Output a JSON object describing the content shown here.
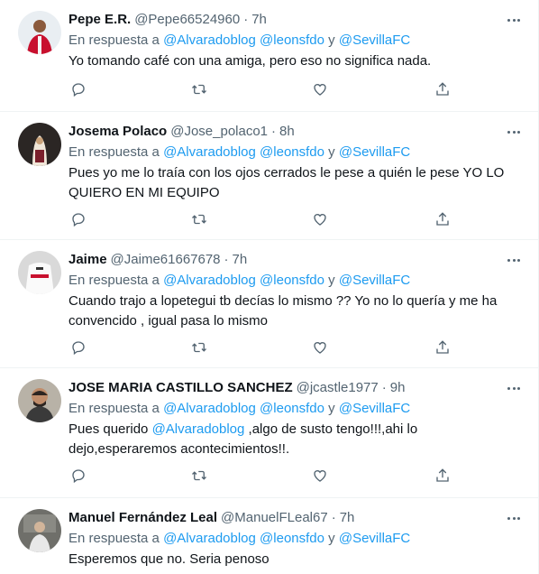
{
  "reply_prefix": "En respuesta a",
  "reply_joiner": "y",
  "separator": "·",
  "tweets": [
    {
      "name": "Pepe E.R.",
      "handle": "@Pepe66524960",
      "time": "7h",
      "mentions": [
        "@Alvaradoblog",
        "@leonsfdo",
        "@SevillaFC"
      ],
      "text": "Yo tomando café con una amiga,  pero eso no significa nada."
    },
    {
      "name": "Josema Polaco",
      "handle": "@Jose_polaco1",
      "time": "8h",
      "mentions": [
        "@Alvaradoblog",
        "@leonsfdo",
        "@SevillaFC"
      ],
      "text_line1": "Pues yo me lo traía con los ojos cerrados le pese a quién le pese YO LO",
      "text_line2": "QUIERO EN MI EQUIPO"
    },
    {
      "name": "Jaime",
      "handle": "@Jaime61667678",
      "time": "7h",
      "mentions": [
        "@Alvaradoblog",
        "@leonsfdo",
        "@SevillaFC"
      ],
      "text_line1": "Cuando trajo a  lopetegui tb decías lo mismo ?? Yo no lo quería y me ha",
      "text_line2": "convencido , igual pasa lo mismo"
    },
    {
      "name": "JOSE MARIA CASTILLO SANCHEZ",
      "handle": "@jcastle1977",
      "time": "9h",
      "mentions": [
        "@Alvaradoblog",
        "@leonsfdo",
        "@SevillaFC"
      ],
      "text_pre": "Pues querido ",
      "text_mention": "@Alvaradoblog",
      "text_post": " ,algo de susto tengo!!!,ahi lo",
      "text_line2": "dejo,esperaremos acontecimientos!!."
    },
    {
      "name": "Manuel Fernández Leal",
      "handle": "@ManuelFLeal67",
      "time": "7h",
      "mentions": [
        "@Alvaradoblog",
        "@leonsfdo",
        "@SevillaFC"
      ],
      "text": "Esperemos que no. Seria penoso"
    }
  ],
  "colors": {
    "text": "#0f1419",
    "secondary": "#536471",
    "link": "#1d9bf0",
    "divider": "#eff3f4"
  },
  "icons": [
    "reply-icon",
    "retweet-icon",
    "like-icon",
    "share-icon",
    "more-icon"
  ]
}
